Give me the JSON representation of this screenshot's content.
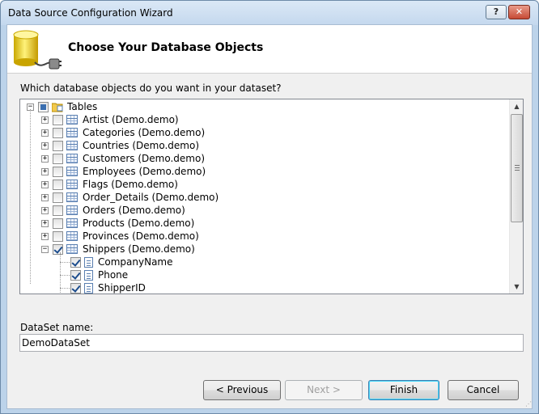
{
  "window": {
    "title": "Data Source Configuration Wizard",
    "help_label": "?",
    "close_label": "✕"
  },
  "header": {
    "title": "Choose Your Database Objects",
    "icon": "database-plug-icon"
  },
  "question": "Which database objects do you want in your dataset?",
  "tree": {
    "root": {
      "label": "Tables",
      "expanded": true,
      "check_state": "partial"
    },
    "tables": [
      {
        "label": "Artist (Demo.demo)",
        "checked": false,
        "expanded": false
      },
      {
        "label": "Categories (Demo.demo)",
        "checked": false,
        "expanded": false
      },
      {
        "label": "Countries (Demo.demo)",
        "checked": false,
        "expanded": false
      },
      {
        "label": "Customers (Demo.demo)",
        "checked": false,
        "expanded": false
      },
      {
        "label": "Employees (Demo.demo)",
        "checked": false,
        "expanded": false
      },
      {
        "label": "Flags (Demo.demo)",
        "checked": false,
        "expanded": false
      },
      {
        "label": "Order_Details (Demo.demo)",
        "checked": false,
        "expanded": false
      },
      {
        "label": "Orders (Demo.demo)",
        "checked": false,
        "expanded": false
      },
      {
        "label": "Products (Demo.demo)",
        "checked": false,
        "expanded": false
      },
      {
        "label": "Provinces (Demo.demo)",
        "checked": false,
        "expanded": false
      },
      {
        "label": "Shippers (Demo.demo)",
        "checked": true,
        "expanded": true
      }
    ],
    "columns": [
      {
        "label": "CompanyName",
        "checked": true
      },
      {
        "label": "Phone",
        "checked": true
      },
      {
        "label": "ShipperID",
        "checked": true
      }
    ],
    "expand_glyph": "+",
    "collapse_glyph": "−"
  },
  "dataset": {
    "label": "DataSet name:",
    "value": "DemoDataSet"
  },
  "buttons": {
    "previous": "< Previous",
    "next": "Next >",
    "finish": "Finish",
    "cancel": "Cancel"
  }
}
